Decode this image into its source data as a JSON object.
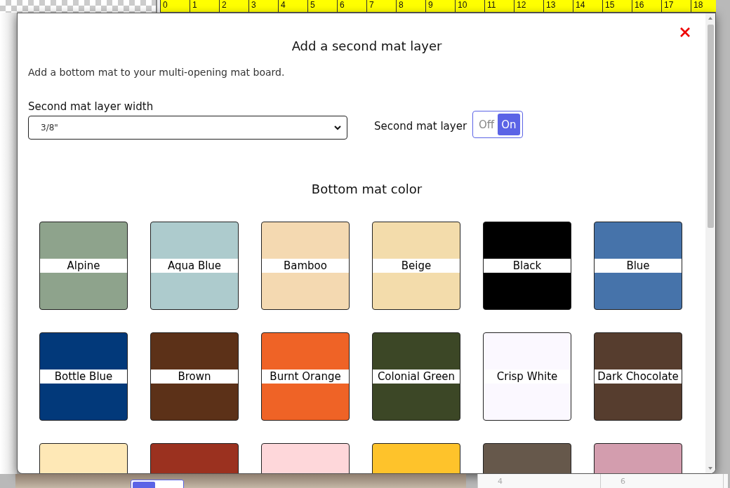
{
  "ruler": {
    "marks": [
      "0",
      "1",
      "2",
      "3",
      "4",
      "5",
      "6",
      "7",
      "8",
      "9",
      "10",
      "11",
      "12",
      "13",
      "14",
      "15",
      "16",
      "17",
      "18"
    ]
  },
  "background_grid": {
    "labels": [
      "4",
      "6"
    ]
  },
  "dialog": {
    "title": "Add a second mat layer",
    "description": "Add a bottom mat to your multi-opening mat board.",
    "width_field": {
      "label": "Second mat layer width",
      "value": "3/8\""
    },
    "layer_toggle": {
      "label": "Second mat layer",
      "options": [
        {
          "label": "Off",
          "selected": false
        },
        {
          "label": "On",
          "selected": true
        }
      ]
    },
    "color_heading": "Bottom mat color",
    "swatches": [
      {
        "name": "Alpine",
        "color": "#8ea38c"
      },
      {
        "name": "Aqua Blue",
        "color": "#adcbcd"
      },
      {
        "name": "Bamboo",
        "color": "#f4d9b1"
      },
      {
        "name": "Beige",
        "color": "#f3dcab"
      },
      {
        "name": "Black",
        "color": "#000000"
      },
      {
        "name": "Blue",
        "color": "#4673aa"
      },
      {
        "name": "Bottle Blue",
        "color": "#02397a"
      },
      {
        "name": "Brown",
        "color": "#5c3118"
      },
      {
        "name": "Burnt Orange",
        "color": "#ef6326"
      },
      {
        "name": "Colonial Green",
        "color": "#3c4726"
      },
      {
        "name": "Crisp White",
        "color": "#fbf8ff"
      },
      {
        "name": "Dark Chocolate",
        "color": "#563d2e"
      },
      {
        "color": "#fee8b6"
      },
      {
        "color": "#9b311f"
      },
      {
        "color": "#fed7da"
      },
      {
        "color": "#fec32b"
      },
      {
        "color": "#66584b"
      },
      {
        "color": "#d39dae"
      }
    ]
  }
}
